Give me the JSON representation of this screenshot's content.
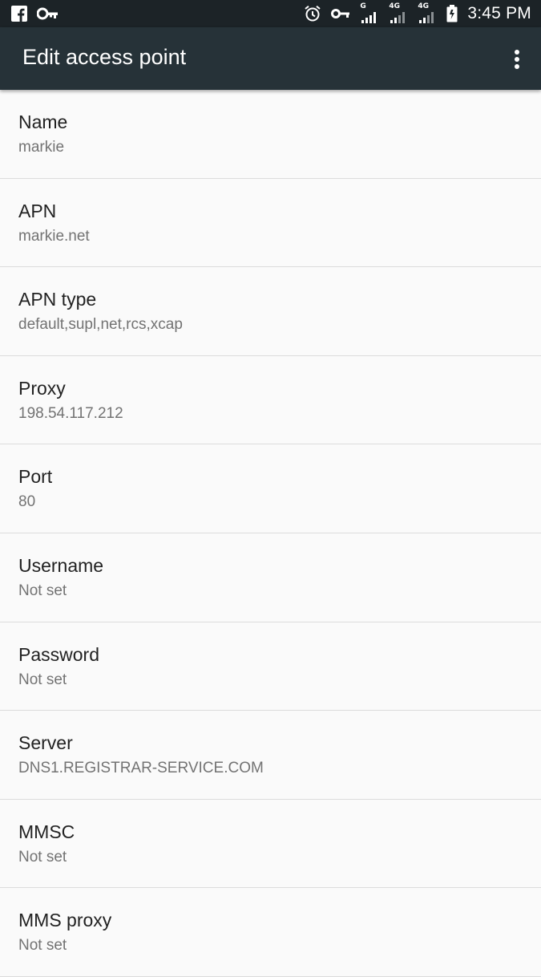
{
  "status_bar": {
    "time": "3:45 PM",
    "network_1": "G",
    "network_2": "4G",
    "network_3": "4G",
    "left_icons": [
      "facebook-icon",
      "key-icon"
    ],
    "right_icons": [
      "alarm-icon",
      "vpn-key-icon",
      "signal-icon",
      "signal-icon",
      "signal-icon",
      "battery-icon"
    ]
  },
  "app_bar": {
    "title": "Edit access point",
    "menu_icon": "more-vert-icon"
  },
  "colors": {
    "status_bar": "#1c2327",
    "app_bar": "#263238",
    "background": "#fafafa",
    "title_text": "#222222",
    "summary_text": "#737373",
    "divider": "#dcdcdc"
  },
  "preferences": [
    {
      "title": "Name",
      "summary": "markie"
    },
    {
      "title": "APN",
      "summary": "markie.net"
    },
    {
      "title": "APN type",
      "summary": "default,supl,net,rcs,xcap"
    },
    {
      "title": "Proxy",
      "summary": "198.54.117.212"
    },
    {
      "title": "Port",
      "summary": "80"
    },
    {
      "title": "Username",
      "summary": "Not set"
    },
    {
      "title": "Password",
      "summary": "Not set"
    },
    {
      "title": "Server",
      "summary": "DNS1.REGISTRAR-SERVICE.COM"
    },
    {
      "title": "MMSC",
      "summary": "Not set"
    },
    {
      "title": "MMS proxy",
      "summary": "Not set"
    }
  ]
}
